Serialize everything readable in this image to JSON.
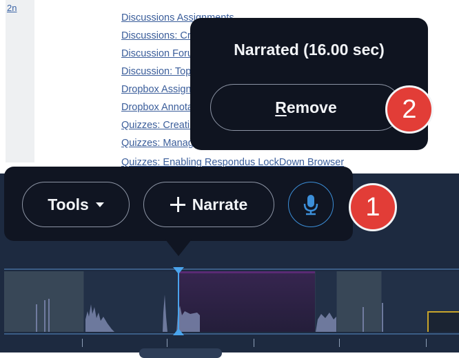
{
  "document": {
    "left_link": "2n",
    "links": [
      "Discussions Assignments",
      "Discussions: Creating",
      "Discussion Forums",
      "Discussion: Topics",
      "Dropbox Assignments",
      "Dropbox Annotations",
      "Quizzes: Creating",
      "Quizzes: Managing",
      "Quizzes: Enabling Respondus LockDown Browser"
    ]
  },
  "toolbar": {
    "tools_label": "Tools",
    "narrate_label": "Narrate",
    "mic_icon": "microphone-icon"
  },
  "narration_popover": {
    "title": "Narrated (16.00 sec)",
    "remove_first_letter": "R",
    "remove_rest": "emove"
  },
  "callouts": {
    "badge_1": "1",
    "badge_2": "2"
  },
  "colors": {
    "popover_bg": "#101522",
    "accent_blue": "#4aa4ec",
    "callout_red": "#e23d37",
    "clip_purple": "#5a2a74"
  }
}
